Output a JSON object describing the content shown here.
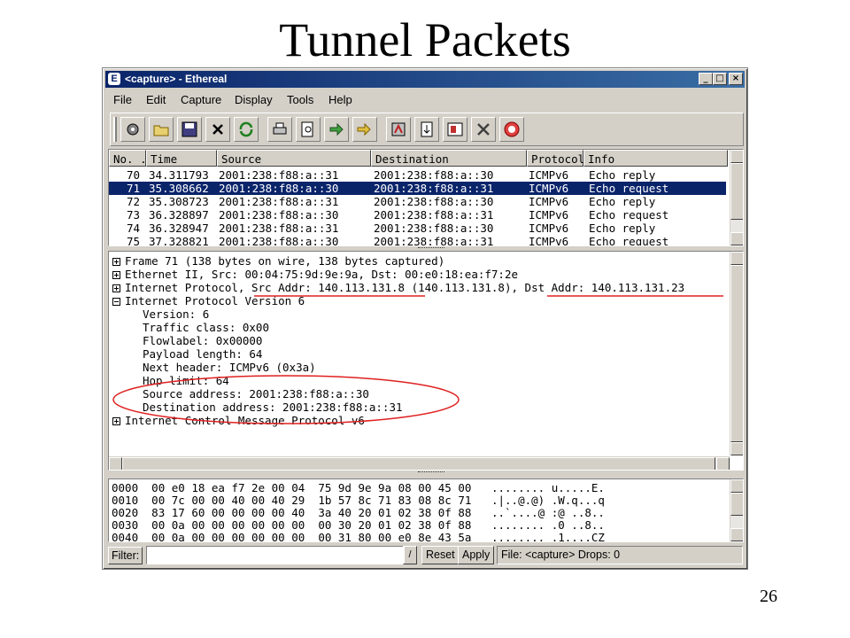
{
  "slide": {
    "title": "Tunnel Packets",
    "page_number": "26"
  },
  "window": {
    "title": "<capture> - Ethereal",
    "controls": {
      "minimize": "_",
      "maximize": "□",
      "close": "×"
    }
  },
  "menu": [
    "File",
    "Edit",
    "Capture",
    "Display",
    "Tools",
    "Help"
  ],
  "toolbar_icons": [
    "settings-icon",
    "open-folder-icon",
    "save-icon",
    "close-x-icon",
    "reload-icon",
    "print-icon",
    "find-icon",
    "go-forward-icon",
    "jump-icon",
    "prefs-icon",
    "filter-icon",
    "display-filter-icon",
    "tools-icon",
    "help-icon"
  ],
  "packet_list": {
    "columns": [
      "No. .",
      "Time",
      "Source",
      "Destination",
      "Protocol",
      "Info"
    ],
    "rows": [
      {
        "no": "70",
        "time": "34.311793",
        "src": "2001:238:f88:a::31",
        "dst": "2001:238:f88:a::30",
        "proto": "ICMPv6",
        "info": "Echo reply"
      },
      {
        "no": "71",
        "time": "35.308662",
        "src": "2001:238:f88:a::30",
        "dst": "2001:238:f88:a::31",
        "proto": "ICMPv6",
        "info": "Echo request"
      },
      {
        "no": "72",
        "time": "35.308723",
        "src": "2001:238:f88:a::31",
        "dst": "2001:238:f88:a::30",
        "proto": "ICMPv6",
        "info": "Echo reply"
      },
      {
        "no": "73",
        "time": "36.328897",
        "src": "2001:238:f88:a::30",
        "dst": "2001:238:f88:a::31",
        "proto": "ICMPv6",
        "info": "Echo request"
      },
      {
        "no": "74",
        "time": "36.328947",
        "src": "2001:238:f88:a::31",
        "dst": "2001:238:f88:a::30",
        "proto": "ICMPv6",
        "info": "Echo reply"
      },
      {
        "no": "75",
        "time": "37.328821",
        "src": "2001:238:f88:a::30",
        "dst": "2001:238:f88:a::31",
        "proto": "ICMPv6",
        "info": "Echo request"
      }
    ],
    "selected_index": 1
  },
  "detail_tree": [
    {
      "indent": 0,
      "toggle": "plus",
      "text": "Frame 71 (138 bytes on wire, 138 bytes captured)"
    },
    {
      "indent": 0,
      "toggle": "plus",
      "text": "Ethernet II, Src: 00:04:75:9d:9e:9a, Dst: 00:e0:18:ea:f7:2e"
    },
    {
      "indent": 0,
      "toggle": "plus",
      "text": "Internet Protocol, Src Addr: 140.113.131.8 (140.113.131.8), Dst Addr: 140.113.131.23"
    },
    {
      "indent": 0,
      "toggle": "minus",
      "text": "Internet Protocol Version 6"
    },
    {
      "indent": 1,
      "toggle": "",
      "text": "Version: 6"
    },
    {
      "indent": 1,
      "toggle": "",
      "text": "Traffic class: 0x00"
    },
    {
      "indent": 1,
      "toggle": "",
      "text": "Flowlabel: 0x00000"
    },
    {
      "indent": 1,
      "toggle": "",
      "text": "Payload length: 64"
    },
    {
      "indent": 1,
      "toggle": "",
      "text": "Next header: ICMPv6 (0x3a)"
    },
    {
      "indent": 1,
      "toggle": "",
      "text": "Hop limit: 64"
    },
    {
      "indent": 1,
      "toggle": "",
      "text": "Source address: 2001:238:f88:a::30"
    },
    {
      "indent": 1,
      "toggle": "",
      "text": "Destination address: 2001:238:f88:a::31"
    },
    {
      "indent": 0,
      "toggle": "plus",
      "text": "Internet Control Message Protocol v6"
    }
  ],
  "hex_dump": [
    {
      "offset": "0000",
      "hex": "00 e0 18 ea f7 2e 00 04  75 9d 9e 9a 08 00 45 00",
      "ascii": "........ u.....E."
    },
    {
      "offset": "0010",
      "hex": "00 7c 00 00 40 00 40 29  1b 57 8c 71 83 08 8c 71",
      "ascii": ".|..@.@) .W.q...q"
    },
    {
      "offset": "0020",
      "hex": "83 17 60 00 00 00 00 40  3a 40 20 01 02 38 0f 88",
      "ascii": "..`....@ :@ ..8.."
    },
    {
      "offset": "0030",
      "hex": "00 0a 00 00 00 00 00 00  00 30 20 01 02 38 0f 88",
      "ascii": "........ .0 ..8.."
    },
    {
      "offset": "0040",
      "hex": "00 0a 00 00 00 00 00 00  00 31 80 00 e0 8e 43 5a",
      "ascii": "........ .1....CZ"
    }
  ],
  "statusbar": {
    "filter_label": "Filter:",
    "filter_value": "",
    "reset_label": "Reset",
    "apply_label": "Apply",
    "status": "File: <capture>  Drops: 0"
  },
  "colors": {
    "selection": "#0a246a",
    "annotation": "#e02020",
    "titlebar": "#0a246a"
  }
}
